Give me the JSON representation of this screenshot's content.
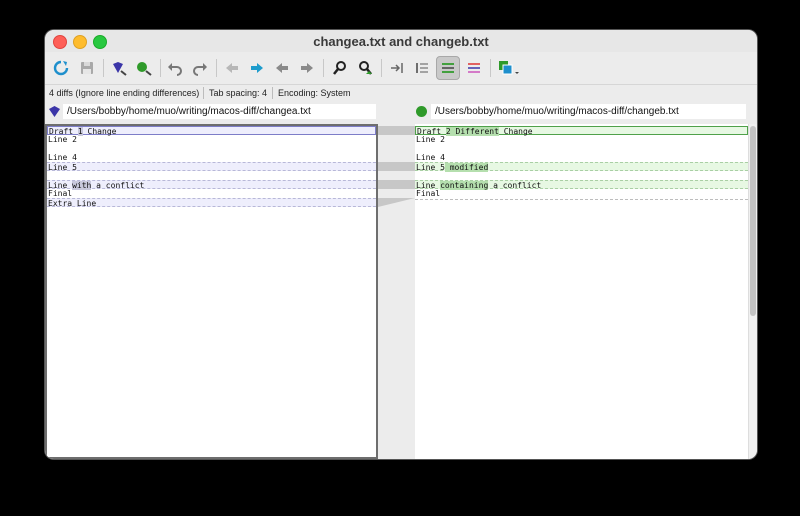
{
  "window": {
    "title": "changea.txt and changeb.txt"
  },
  "toolbar": {
    "icons": [
      "refresh-icon",
      "save-icon",
      "left-file-icon",
      "right-file-icon",
      "undo-icon",
      "redo-icon",
      "previous-difference-icon",
      "next-difference-icon",
      "previous-conflict-icon",
      "next-conflict-icon",
      "search-icon",
      "search-next-icon",
      "tab-icon",
      "line-numbers-icon",
      "line-diff-view-icon",
      "diff-pane-icon",
      "options-dropdown-icon"
    ],
    "colors": {
      "accent": "#1e8fcc",
      "left_file": "#3b35a8",
      "right_file": "#2f9a2a"
    }
  },
  "status": {
    "diffs": "4 diffs (Ignore line ending differences)",
    "tab_spacing": "Tab spacing: 4",
    "encoding": "Encoding: System"
  },
  "left": {
    "path": "/Users/bobby/home/muo/writing/macos-diff/changea.txt",
    "lines": {
      "l1a": "Draft ",
      "l1b": "1",
      "l1c": " Change",
      "l2": "Line 2",
      "l4": "Line 4",
      "l5": "Line 5",
      "l7a": "Line ",
      "l7b": "with",
      "l7c": " a conflict",
      "l8": "Final",
      "l9": "Extra Line"
    }
  },
  "right": {
    "path": "/Users/bobby/home/muo/writing/macos-diff/changeb.txt",
    "lines": {
      "l1a": "Draft ",
      "l1b": "2 Different",
      "l1c": " Change",
      "l2": "Line 2",
      "l4": "Line 4",
      "l5a": "Line 5",
      "l5b": " modified",
      "l7a": "Line ",
      "l7b": "containing",
      "l7c": " a conflict",
      "l8": "Final"
    }
  }
}
